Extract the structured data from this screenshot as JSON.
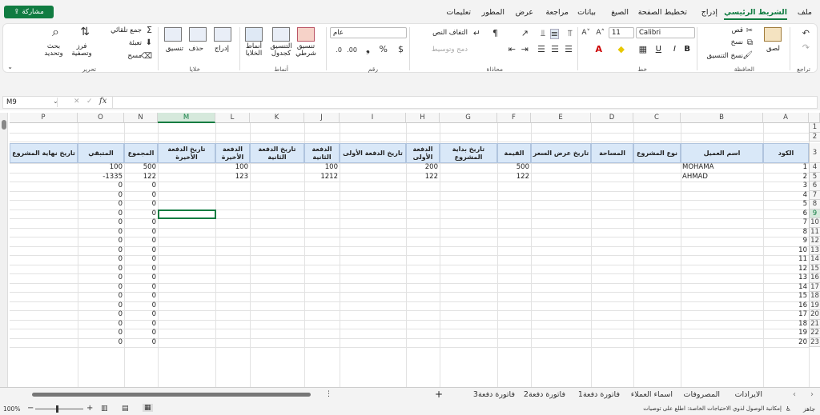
{
  "menubar": {
    "share": "مشاركة",
    "items": [
      "ملف",
      "الشريط الرئيسي",
      "إدراج",
      "تخطيط الصفحة",
      "الصيغ",
      "بيانات",
      "مراجعة",
      "عرض",
      "المطور",
      "تعليمات"
    ]
  },
  "ribbon": {
    "undo_group": "تراجع",
    "paste": "لصق",
    "cut": "قص",
    "copy": "نسخ",
    "format_painter": "نسخ التنسيق",
    "clipboard_group": "الحافظة",
    "font_name": "Calibri",
    "font_size": "11",
    "bold": "B",
    "italic": "I",
    "underline": "U",
    "font_group": "خط",
    "wrap_text": "التفاف النص",
    "merge_center": "دمج وتوسيط",
    "alignment_group": "محاذاة",
    "number_format": "عام",
    "number_group": "رقم",
    "conditional_format": "تنسيق شرطي",
    "format_as_table": "التنسيق كجدول",
    "cell_styles": "أنماط الخلايا",
    "styles_group": "أنماط",
    "insert": "إدراج",
    "delete": "حذف",
    "format": "تنسيق",
    "cells_group": "خلايا",
    "autosum": "جمع تلقائي",
    "fill": "تعبئة",
    "clear": "مسح",
    "sort_filter": "فرز وتصفية",
    "find_select": "بحث وتحديد",
    "editing_group": "تحرير"
  },
  "formula_bar": {
    "name_box": "M9",
    "fx": "fx",
    "formula": ""
  },
  "columns": [
    "A",
    "B",
    "C",
    "D",
    "E",
    "F",
    "G",
    "H",
    "I",
    "J",
    "K",
    "L",
    "M",
    "N",
    "O",
    "P"
  ],
  "row_numbers": [
    "1",
    "2",
    "3",
    "4",
    "5",
    "6",
    "7",
    "8",
    "9",
    "10",
    "11",
    "12",
    "13",
    "14",
    "15",
    "16",
    "17",
    "18",
    "19",
    "20",
    "21",
    "22",
    "23"
  ],
  "grid_row_labels": [
    "1",
    "2",
    "3",
    "4",
    "5",
    "6",
    "7",
    "8",
    "9",
    "10",
    "11",
    "12",
    "13",
    "14",
    "15",
    "16",
    "17",
    "18",
    "19",
    "20",
    "21",
    "22",
    "23"
  ],
  "headers": {
    "A": "الكود",
    "B": "اسم العميل",
    "C": "نوع المشروع",
    "D": "المساحة",
    "E": "تاريخ عرض السعر",
    "F": "القيمة",
    "G": "تاريخ بداية المشروع",
    "H": "الدفعة الأولى",
    "I": "تاريخ الدفعة الأولى",
    "J": "الدفعة الثانية",
    "K": "تاريخ الدفعة الثانية",
    "L": "الدفعة الأخيرة",
    "M": "تاريخ الدفعة الأخيرة",
    "N": "المجموع",
    "O": "المتبقي",
    "P": "تاريخ نهاية المشروع"
  },
  "data_rows": [
    {
      "B": "MOHAMA",
      "F": "500",
      "H": "200",
      "J": "100",
      "L": "100",
      "N": "500",
      "O": "100"
    },
    {
      "B": "AHMAD",
      "F": "122",
      "H": "122",
      "J": "1212",
      "L": "123",
      "N": "122",
      "O": "-1335"
    }
  ],
  "zero": "0",
  "sheet_tabs": [
    "الايرادات",
    "المصروفات",
    "اسماء العملاء",
    "فاتورة دفعة1",
    "فاتورة دفعة2",
    "فاتورة دفعة3"
  ],
  "status": {
    "ready": "جاهز",
    "accessibility": "إمكانية الوصول لذوي الاحتياجات الخاصة: اطلع على توصيات",
    "zoom": "100%"
  },
  "colors": {
    "accent": "#107c41",
    "header_fill": "#d9e8f8"
  }
}
